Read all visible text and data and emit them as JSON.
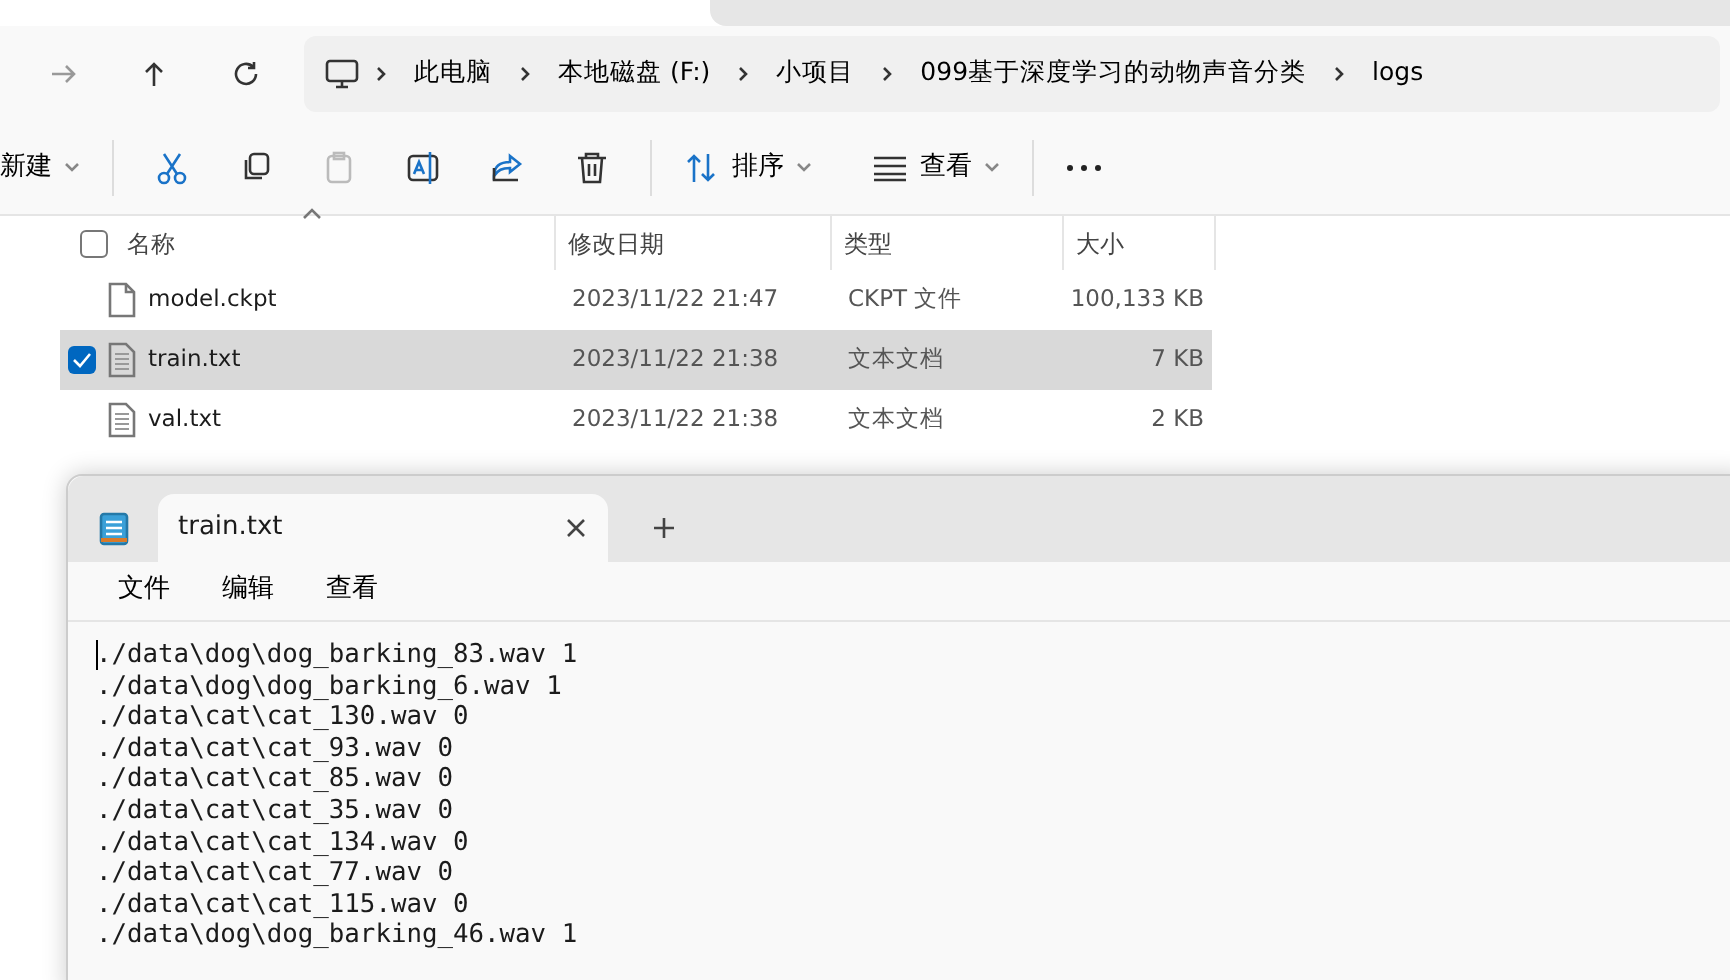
{
  "breadcrumb": [
    "此电脑",
    "本地磁盘 (F:)",
    "小项目",
    "099基于深度学习的动物声音分类",
    "logs"
  ],
  "toolbar": {
    "new_label": "新建",
    "sort_label": "排序",
    "view_label": "查看"
  },
  "columns": [
    "名称",
    "修改日期",
    "类型",
    "大小"
  ],
  "select_all_checked": false,
  "files": [
    {
      "name": "model.ckpt",
      "date": "2023/11/22 21:47",
      "type": "CKPT 文件",
      "size": "100,133 KB",
      "kind": "file",
      "selected": false
    },
    {
      "name": "train.txt",
      "date": "2023/11/22 21:38",
      "type": "文本文档",
      "size": "7 KB",
      "kind": "text",
      "selected": true
    },
    {
      "name": "val.txt",
      "date": "2023/11/22 21:38",
      "type": "文本文档",
      "size": "2 KB",
      "kind": "text",
      "selected": false
    }
  ],
  "notepad": {
    "tab_title": "train.txt",
    "menu": [
      "文件",
      "编辑",
      "查看"
    ],
    "lines": [
      "./data\\dog\\dog_barking_83.wav 1",
      "./data\\dog\\dog_barking_6.wav 1",
      "./data\\cat\\cat_130.wav 0",
      "./data\\cat\\cat_93.wav 0",
      "./data\\cat\\cat_85.wav 0",
      "./data\\cat\\cat_35.wav 0",
      "./data\\cat\\cat_134.wav 0",
      "./data\\cat\\cat_77.wav 0",
      "./data\\cat\\cat_115.wav 0",
      "./data\\dog\\dog_barking_46.wav 1"
    ]
  }
}
